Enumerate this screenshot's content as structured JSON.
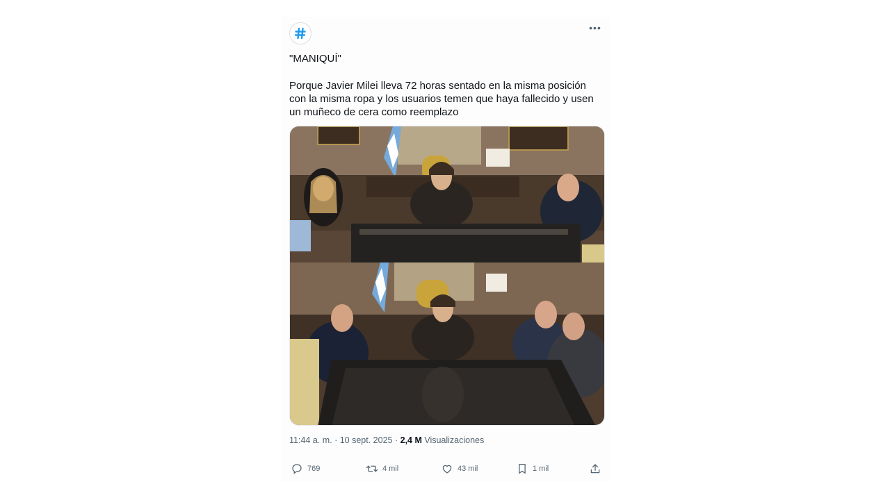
{
  "post": {
    "avatar_icon": "hashtag-icon",
    "more_icon": "more-icon",
    "headline": "\"MANIQUÍ\"",
    "body": "Porque Javier Milei lleva 72 horas sentado en la misma posición con la misma ropa y los usuarios temen que haya fallecido y usen un muñeco de cera como reemplazo",
    "media": [
      "photo-top",
      "photo-bottom"
    ]
  },
  "meta": {
    "time": "11:44 a. m.",
    "sep1": " · ",
    "date": "10 sept. 2025",
    "sep2": " · ",
    "views_count": "2,4 M",
    "views_label": " Visualizaciones"
  },
  "actions": {
    "replies": "769",
    "reposts": "4 mil",
    "likes": "43 mil",
    "bookmarks": "1 mil"
  },
  "colors": {
    "accent": "#1d9bf0",
    "muted": "#536471",
    "text": "#0f1419"
  }
}
